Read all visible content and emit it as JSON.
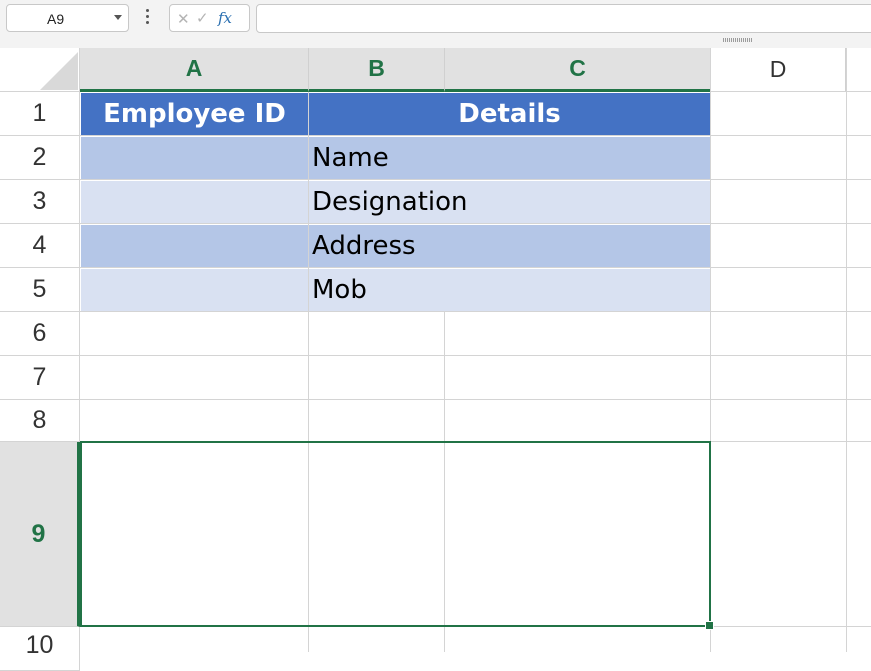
{
  "formula_bar": {
    "name_box": "A9",
    "cancel_icon": "close-icon",
    "enter_icon": "check-icon",
    "fx_label": "fx",
    "formula_value": ""
  },
  "columns": [
    "A",
    "B",
    "C",
    "D"
  ],
  "rows": [
    "1",
    "2",
    "3",
    "4",
    "5",
    "6",
    "7",
    "8",
    "9",
    "10"
  ],
  "selected_cell": "A9",
  "table": {
    "header": {
      "employee_id": "Employee ID",
      "details": "Details"
    },
    "details": [
      "Name",
      "Designation",
      "Address",
      "Mob"
    ]
  },
  "colors": {
    "accent": "#217346",
    "table_header": "#4472c4",
    "band_dark": "#b4c6e7",
    "band_light": "#d9e1f2"
  }
}
